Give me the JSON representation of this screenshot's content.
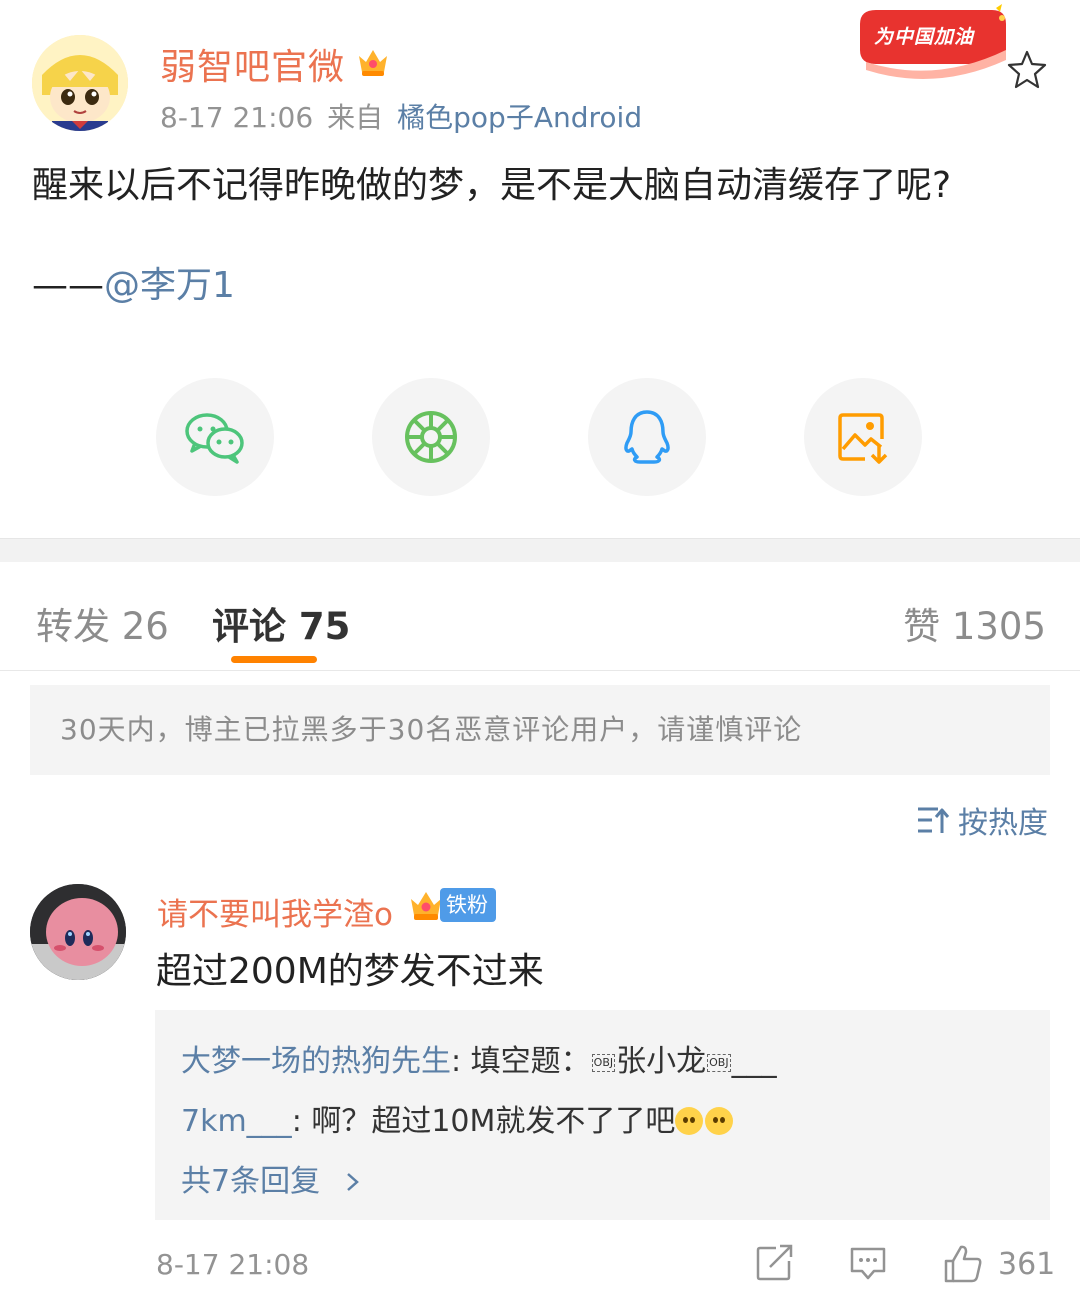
{
  "post": {
    "author": "弱智吧官微",
    "time": "8-17 21:06",
    "source_prefix": "来自",
    "source": "橘色pop子Android",
    "promo_badge": "为中国加油",
    "text": "醒来以后不记得昨晚做的梦，是不是大脑自动清缓存了呢?",
    "mention_prefix": "——",
    "mention": "@李万1"
  },
  "share": {
    "items": [
      "wechat-icon",
      "moments-icon",
      "qq-icon",
      "save-image-icon"
    ],
    "colors": {
      "wechat": "#4dc57b",
      "moments": "#67c15e",
      "qq": "#2f9cf5",
      "save": "#ff9c00"
    }
  },
  "tabs": {
    "repost": "转发 26",
    "comment": "评论 75",
    "like": "赞 1305"
  },
  "notice": "30天内，博主已拉黑多于30名恶意评论用户，请谨慎评论",
  "sort": {
    "label": "按热度"
  },
  "comment": {
    "author": "请不要叫我学渣o",
    "badge": "铁粉",
    "text": "超过200M的梦发不过来",
    "reply": {
      "author": "大梦一场的热狗先生",
      "part1": ": 填空题：",
      "part2": "张小龙",
      "part3": "___",
      "line2_start": "7km___",
      "line2_text": ": 啊？超过10M就发不了了吧",
      "obj_marker": "OBJ",
      "more": "共7条回复"
    },
    "time": "8-17 21:08",
    "likes": "361"
  },
  "colors": {
    "accent_orange": "#ff8200",
    "name_orange": "#eb7350",
    "link_blue": "#5b7fa6",
    "fan_badge": "#4f9be8"
  }
}
